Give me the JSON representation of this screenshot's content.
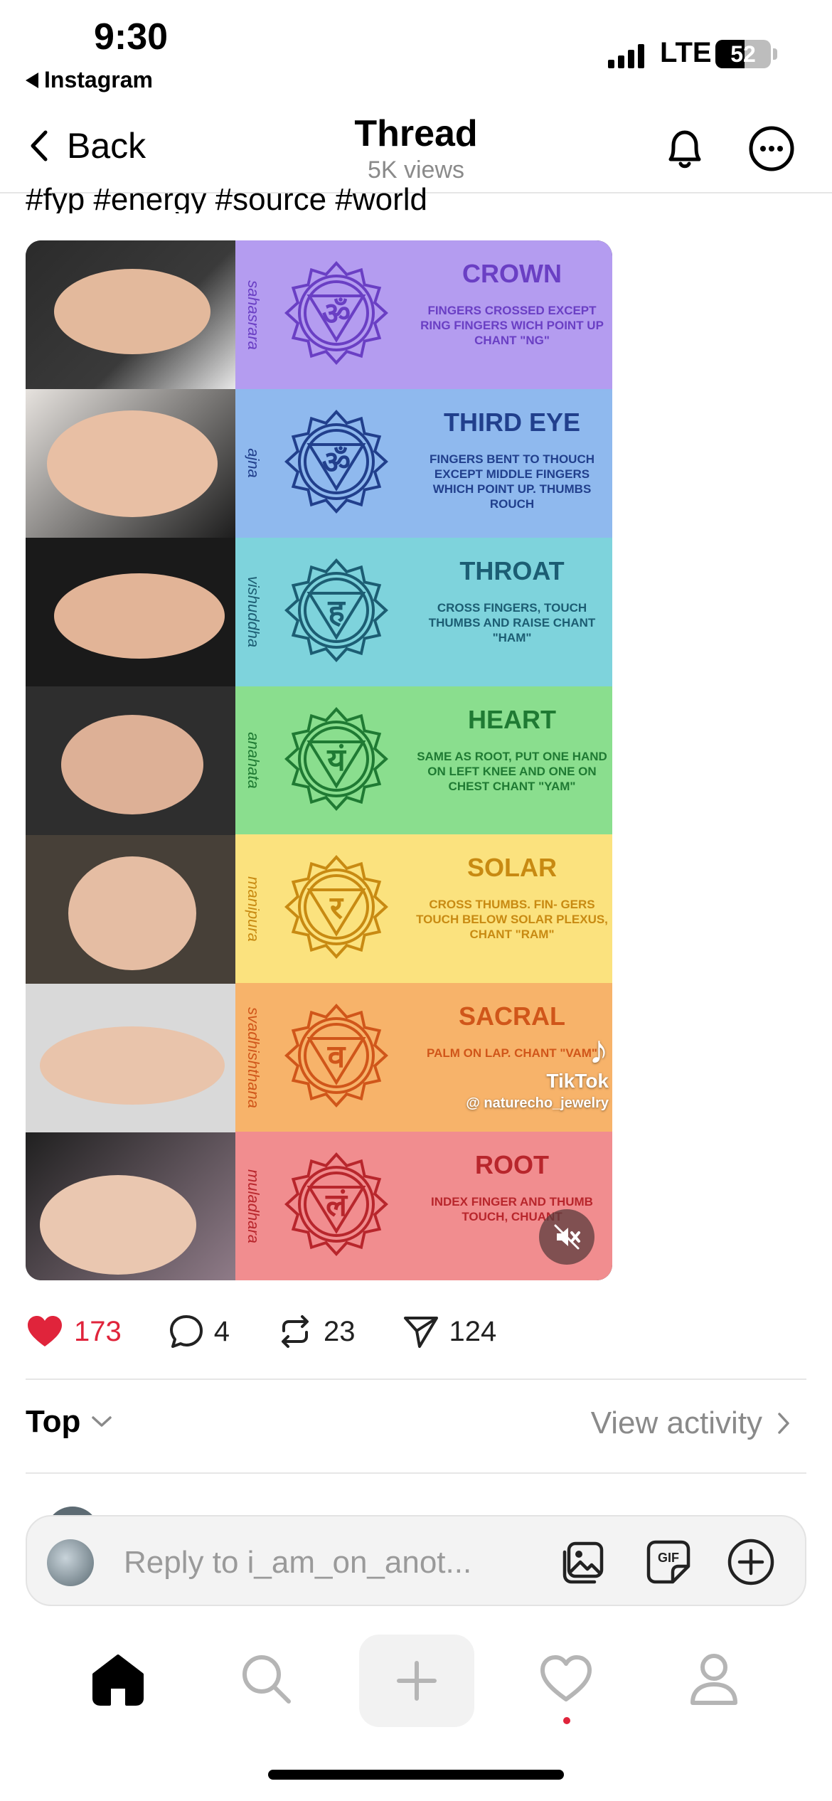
{
  "status_bar": {
    "time": "9:30",
    "back_app": "Instagram",
    "network": "LTE",
    "battery": "52",
    "battery_level": 0.52
  },
  "nav": {
    "back_label": "Back",
    "title": "Thread",
    "subtitle": "5K views"
  },
  "post": {
    "caption": "#fyp #energy #source #world",
    "chakras": [
      {
        "sanskrit": "sahasrara",
        "name": "CROWN",
        "glyph": "ॐ",
        "desc": "FINGERS CROSSED EXCEPT RING FINGERS WICH POINT UP CHANT \"NG\"",
        "bg": "#b49cf0",
        "ink": "#6a3fc4"
      },
      {
        "sanskrit": "ajna",
        "name": "THIRD EYE",
        "glyph": "ॐ",
        "desc": "FINGERS BENT TO THOUCH EXCEPT MIDDLE FINGERS WHICH POINT UP. THUMBS ROUCH",
        "bg": "#8fb9ee",
        "ink": "#213f8c"
      },
      {
        "sanskrit": "vishuddha",
        "name": "THROAT",
        "glyph": "ह",
        "desc": "CROSS FINGERS, TOUCH THUMBS AND RAISE CHANT \"HAM\"",
        "bg": "#7ed3dc",
        "ink": "#1c5d73"
      },
      {
        "sanskrit": "anahata",
        "name": "HEART",
        "glyph": "यं",
        "desc": "SAME AS ROOT, PUT ONE HAND ON LEFT KNEE AND ONE ON CHEST CHANT \"YAM\"",
        "bg": "#8ade8e",
        "ink": "#1f7a33"
      },
      {
        "sanskrit": "manipura",
        "name": "SOLAR",
        "glyph": "र",
        "desc": "CROSS THUMBS. FIN- GERS TOUCH BELOW SOLAR PLEXUS, CHANT \"RAM\"",
        "bg": "#fbe27e",
        "ink": "#c88a12"
      },
      {
        "sanskrit": "svadhishthana",
        "name": "SACRAL",
        "glyph": "व",
        "desc": "PALM ON LAP. CHANT \"VAM\"",
        "bg": "#f7b36a",
        "ink": "#d0561a"
      },
      {
        "sanskrit": "muladhara",
        "name": "ROOT",
        "glyph": "लं",
        "desc": "INDEX FINGER AND THUMB TOUCH, CHUANT",
        "bg": "#f18d8f",
        "ink": "#b8262c"
      }
    ],
    "watermark": {
      "brand": "TikTok",
      "handle": "@ naturecho_jewelry"
    },
    "stats": {
      "likes": "173",
      "comments": "4",
      "reposts": "23",
      "shares": "124"
    }
  },
  "replies": {
    "sort_label": "Top",
    "activity_label": "View activity"
  },
  "composer": {
    "placeholder": "Reply to i_am_on_anot..."
  },
  "tabs": [
    "home",
    "search",
    "create",
    "activity",
    "profile"
  ]
}
